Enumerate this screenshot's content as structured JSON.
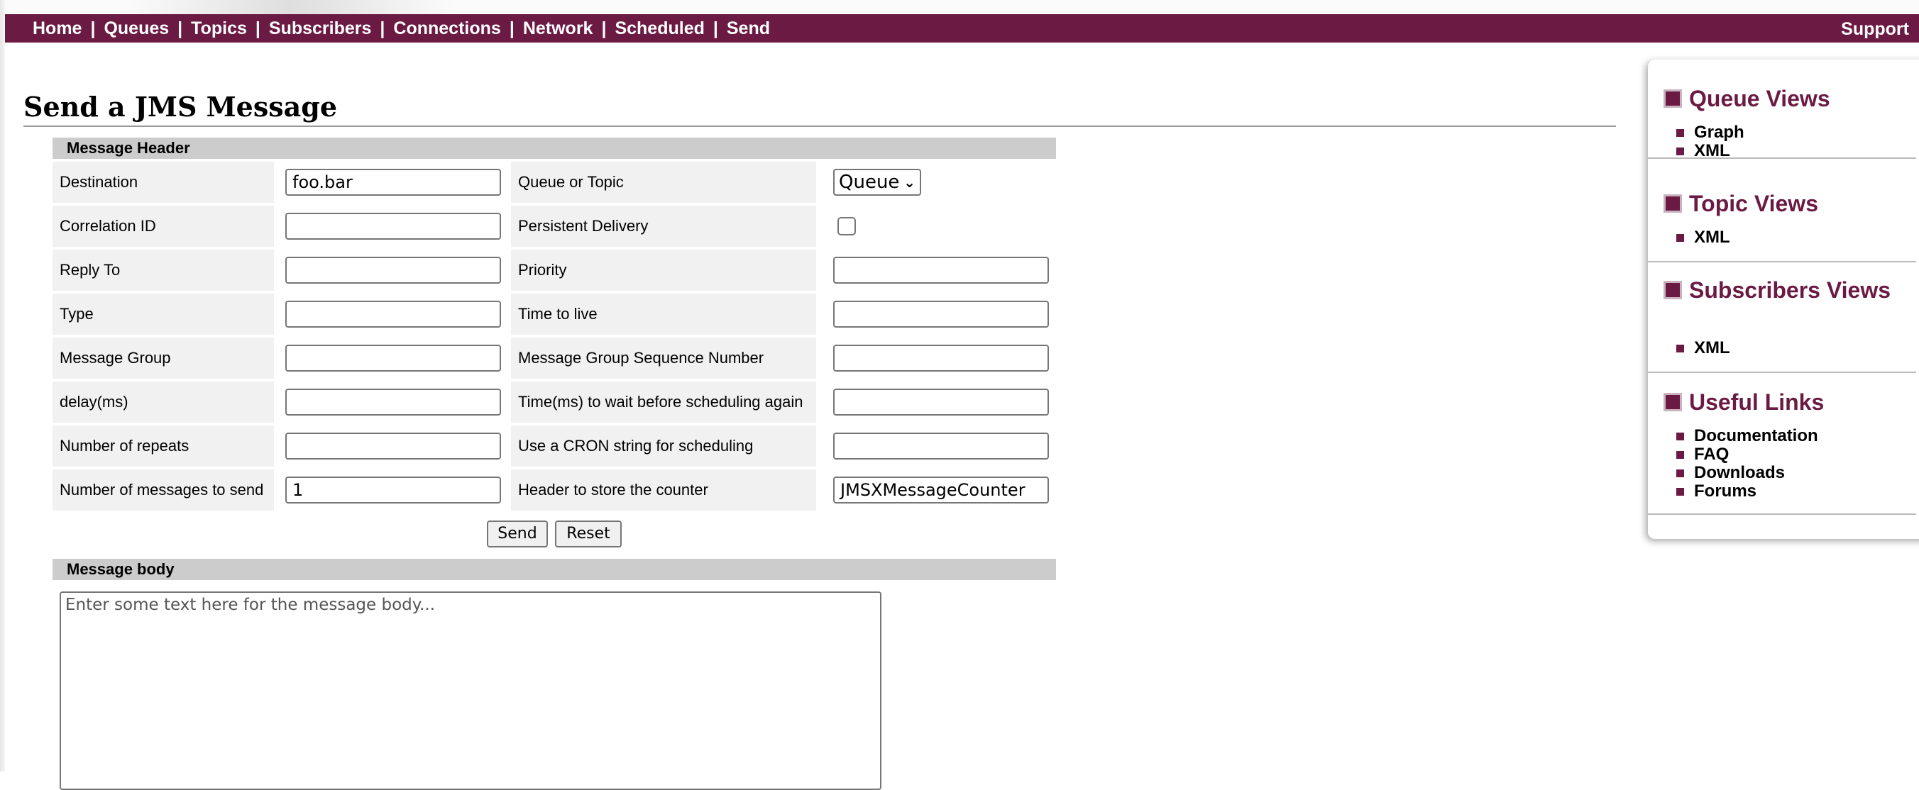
{
  "nav": {
    "items": [
      "Home",
      "Queues",
      "Topics",
      "Subscribers",
      "Connections",
      "Network",
      "Scheduled",
      "Send"
    ],
    "separator": "|",
    "support": "Support"
  },
  "page": {
    "title": "Send a JMS Message"
  },
  "header_section": {
    "title": "Message Header",
    "rows": [
      {
        "left_label": "Destination",
        "left_value": "foo.bar",
        "right_label": "Queue or Topic",
        "right_value": "Queue"
      },
      {
        "left_label": "Correlation ID",
        "left_value": "",
        "right_label": "Persistent Delivery",
        "right_checked": false
      },
      {
        "left_label": "Reply To",
        "left_value": "",
        "right_label": "Priority",
        "right_value": ""
      },
      {
        "left_label": "Type",
        "left_value": "",
        "right_label": "Time to live",
        "right_value": ""
      },
      {
        "left_label": "Message Group",
        "left_value": "",
        "right_label": "Message Group Sequence Number",
        "right_value": ""
      },
      {
        "left_label": "delay(ms)",
        "left_value": "",
        "right_label": "Time(ms) to wait before scheduling again",
        "right_value": ""
      },
      {
        "left_label": "Number of repeats",
        "left_value": "",
        "right_label": "Use a CRON string for scheduling",
        "right_value": ""
      },
      {
        "left_label": "Number of messages to send",
        "left_value": "1",
        "right_label": "Header to store the counter",
        "right_value": "JMSXMessageCounter"
      }
    ]
  },
  "buttons": {
    "send": "Send",
    "reset": "Reset"
  },
  "body_section": {
    "title": "Message body",
    "text": "Enter some text here for the message body..."
  },
  "sidebar": {
    "sections": [
      {
        "title": "Queue Views",
        "links": [
          "Graph",
          "XML"
        ]
      },
      {
        "title": "Topic Views",
        "links": [
          "XML"
        ]
      },
      {
        "title": "Subscribers Views",
        "links": [
          "XML"
        ]
      },
      {
        "title": "Useful Links",
        "links": [
          "Documentation",
          "FAQ",
          "Downloads",
          "Forums"
        ]
      }
    ]
  },
  "colors": {
    "brand": "#6b1a44",
    "section_bar": "#cccccc",
    "cell_bg": "#f1f1f1"
  },
  "icons": {
    "select_chevron": "chevron-down-icon",
    "sidebar_section": "square-icon",
    "sidebar_bullet": "bullet-icon"
  }
}
